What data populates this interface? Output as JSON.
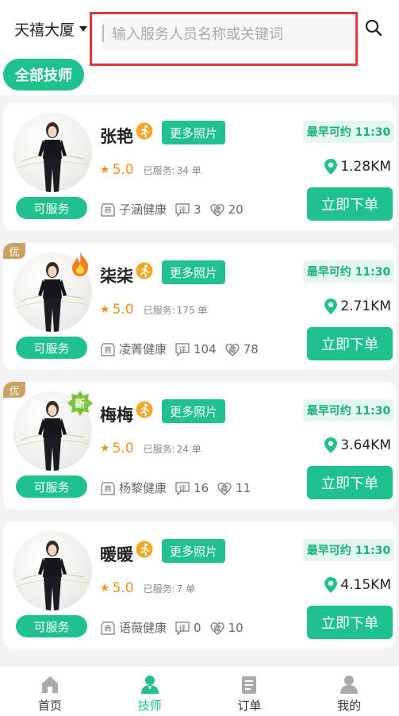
{
  "header": {
    "location": "天禧大厦",
    "search_placeholder": "输入服务人员名称或关键词",
    "search_value": ""
  },
  "filter": {
    "all_label": "全部技师"
  },
  "labels": {
    "photos": "更多照片",
    "earliest_prefix": "最早可约",
    "served": "已服务:",
    "order": "立即下单",
    "status": "可服务",
    "you": "优",
    "new": "新",
    "shop_icon": "商",
    "review_icon": "评",
    "fav_icon": "藏"
  },
  "technicians": [
    {
      "name": "张艳",
      "earliest": "最早可约 11:30",
      "rating": "5.0",
      "served": "34 单",
      "distance": "1.28KM",
      "shop": "子涵健康",
      "reviews": "3",
      "favorites": "20",
      "badge": "",
      "you": false
    },
    {
      "name": "柒柒",
      "earliest": "最早可约 11:30",
      "rating": "5.0",
      "served": "175 单",
      "distance": "2.71KM",
      "shop": "凌菁健康",
      "reviews": "104",
      "favorites": "78",
      "badge": "fire",
      "you": true
    },
    {
      "name": "梅梅",
      "earliest": "最早可约 11:30",
      "rating": "5.0",
      "served": "24 单",
      "distance": "3.64KM",
      "shop": "杨黎健康",
      "reviews": "16",
      "favorites": "11",
      "badge": "new",
      "you": true
    },
    {
      "name": "暖暖",
      "earliest": "最早可约 11:30",
      "rating": "5.0",
      "served": "7 单",
      "distance": "4.15KM",
      "shop": "语薇健康",
      "reviews": "0",
      "favorites": "10",
      "badge": "",
      "you": false
    }
  ],
  "tabs": [
    {
      "label": "首页",
      "icon": "home-icon",
      "active": false
    },
    {
      "label": "技师",
      "icon": "technician-icon",
      "active": true
    },
    {
      "label": "订单",
      "icon": "order-icon",
      "active": false
    },
    {
      "label": "我的",
      "icon": "profile-icon",
      "active": false
    }
  ],
  "colors": {
    "accent": "#1fc28e",
    "rating": "#f5921e",
    "highlight_box": "#e0373b",
    "you_tag": "#c9a35f"
  }
}
